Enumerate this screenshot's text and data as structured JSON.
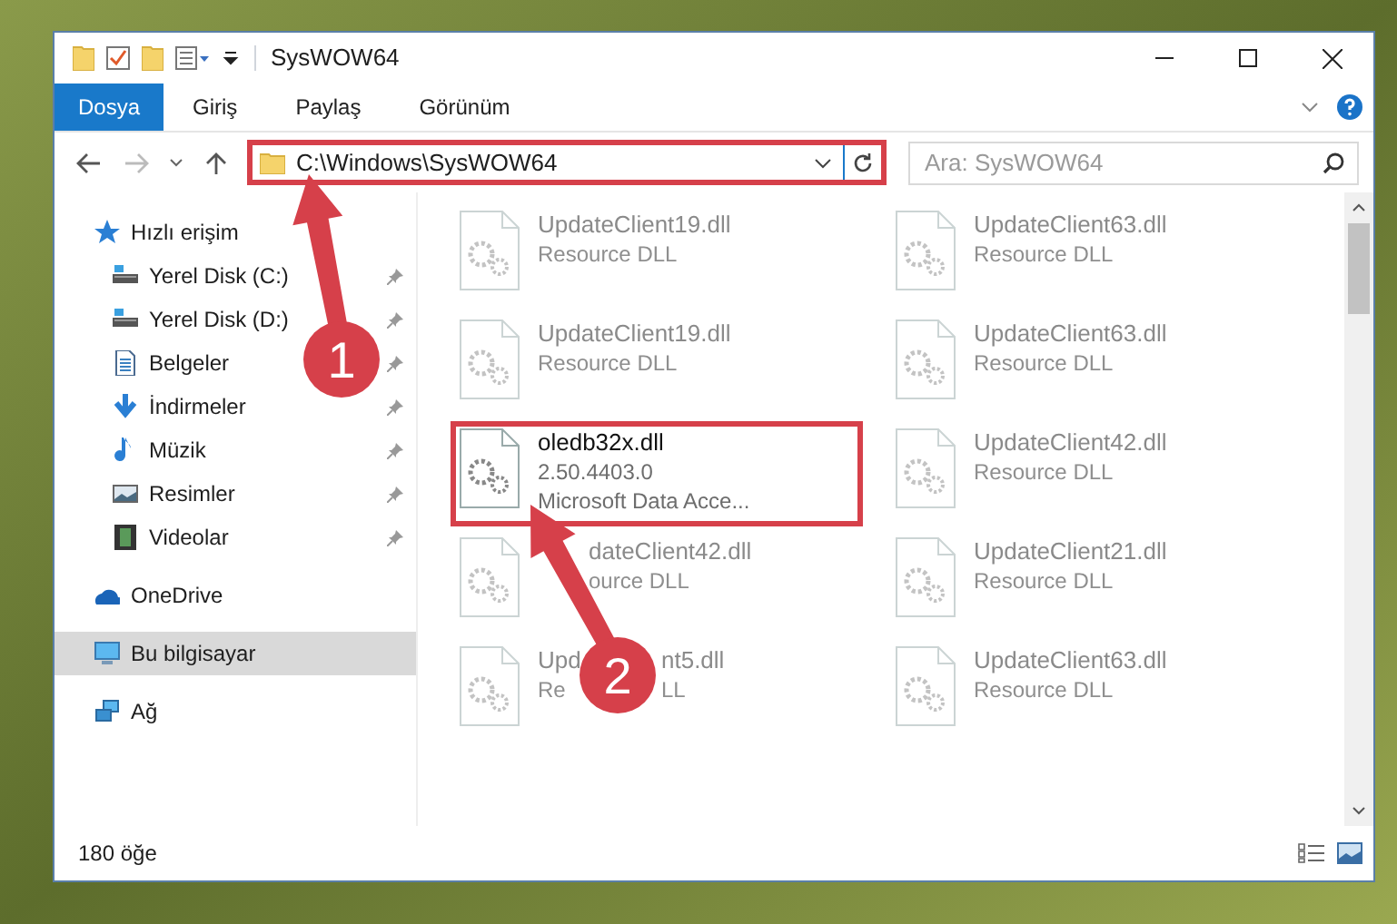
{
  "window": {
    "title": "SysWOW64"
  },
  "ribbon_tabs": [
    {
      "label": "Dosya",
      "selected": true
    },
    {
      "label": "Giriş",
      "selected": false
    },
    {
      "label": "Paylaş",
      "selected": false
    },
    {
      "label": "Görünüm",
      "selected": false
    }
  ],
  "address_bar": {
    "path": "C:\\Windows\\SysWOW64",
    "highlighted": true
  },
  "search": {
    "placeholder": "Ara: SysWOW64"
  },
  "sidebar": {
    "items": [
      {
        "label": "Hızlı erişim",
        "kind": "star",
        "selected": false,
        "children": [
          {
            "label": "Yerel Disk (C:)",
            "kind": "drive",
            "pinned": true,
            "selected": false
          },
          {
            "label": "Yerel Disk (D:)",
            "kind": "drive",
            "pinned": true,
            "selected": false
          },
          {
            "label": "Belgeler",
            "kind": "document",
            "pinned": true,
            "selected": false
          },
          {
            "label": "İndirmeler",
            "kind": "download",
            "pinned": true,
            "selected": false
          },
          {
            "label": "Müzik",
            "kind": "music",
            "pinned": true,
            "selected": false
          },
          {
            "label": "Resimler",
            "kind": "picture",
            "pinned": true,
            "selected": false
          },
          {
            "label": "Videolar",
            "kind": "film",
            "pinned": true,
            "selected": false
          }
        ]
      },
      {
        "label": "OneDrive",
        "kind": "cloud",
        "selected": false
      },
      {
        "label": "Bu bilgisayar",
        "kind": "monitor",
        "selected": true
      },
      {
        "label": "Ağ",
        "kind": "network",
        "selected": false
      }
    ]
  },
  "files": [
    {
      "name": [
        "UpdateClient19.dll"
      ],
      "line2": [
        "Resource DLL"
      ],
      "blurred": true,
      "highlighted": false
    },
    {
      "name": [
        "UpdateClient63.dll"
      ],
      "line2": [
        "Resource DLL"
      ],
      "blurred": true,
      "highlighted": false
    },
    {
      "name": [
        "UpdateClient19.dll"
      ],
      "line2": [
        "Resource DLL"
      ],
      "blurred": true,
      "highlighted": false
    },
    {
      "name": [
        "UpdateClient63.dll"
      ],
      "line2": [
        "Resource DLL"
      ],
      "blurred": true,
      "highlighted": false
    },
    {
      "name": [
        "oledb32x.dll"
      ],
      "line2": [
        "2.50.4403.0"
      ],
      "line3": "Microsoft Data Acce...",
      "blurred": false,
      "highlighted": true
    },
    {
      "name": [
        "UpdateClient42.dll"
      ],
      "line2": [
        "Resource DLL"
      ],
      "blurred": true,
      "highlighted": false
    },
    {
      "name": [
        "dateClient42.dll"
      ],
      "line2": [
        "ource DLL"
      ],
      "blurred": true,
      "highlighted": false
    },
    {
      "name": [
        "UpdateClient21.dll"
      ],
      "line2": [
        "Resource DLL"
      ],
      "blurred": true,
      "highlighted": false
    },
    {
      "name": [
        "Upd",
        "nt5.dll"
      ],
      "line2": [
        "Re",
        "LL"
      ],
      "blurred": true,
      "highlighted": false
    },
    {
      "name": [
        "UpdateClient63.dll"
      ],
      "line2": [
        "Resource DLL"
      ],
      "blurred": true,
      "highlighted": false
    }
  ],
  "status_bar": {
    "count": "180 öğe"
  },
  "annotations": [
    {
      "number": "1"
    },
    {
      "number": "2"
    }
  ]
}
